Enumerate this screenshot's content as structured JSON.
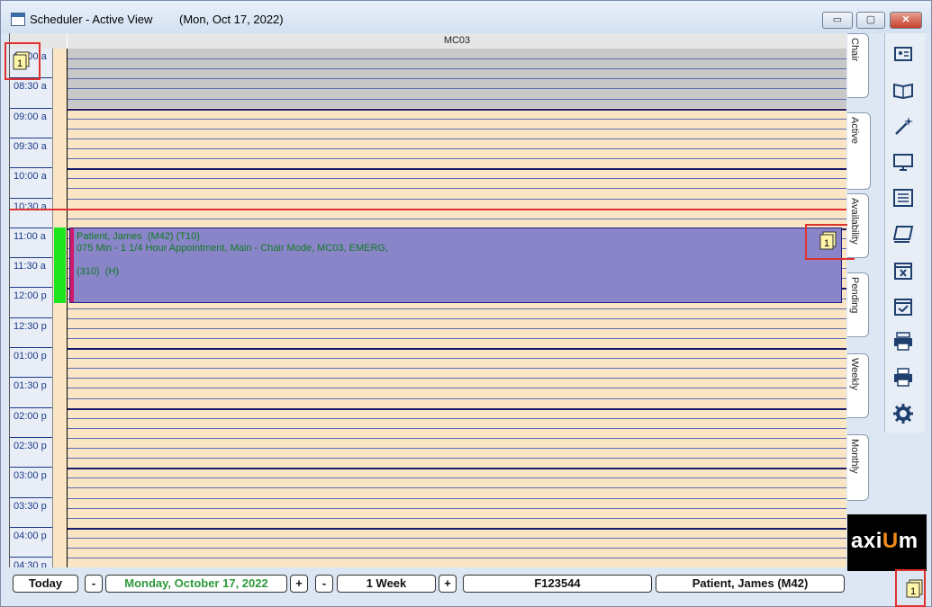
{
  "window": {
    "title": "Scheduler - Active View",
    "date": "(Mon, Oct 17, 2022)",
    "minimize": "▭",
    "maximize": "▢",
    "close": "✕"
  },
  "column": {
    "header": "MC03"
  },
  "times": [
    "08:00 a",
    "08:30 a",
    "09:00 a",
    "09:30 a",
    "10:00 a",
    "10:30 a",
    "11:00 a",
    "11:30 a",
    "12:00 p",
    "12:30 p",
    "01:00 p",
    "01:30 p",
    "02:00 p",
    "02:30 p",
    "03:00 p",
    "03:30 p",
    "04:00 p",
    "04:30 p"
  ],
  "appointment": {
    "line1": "Patient, James  (M42) (T10)",
    "line2": "075 Min - 1 1/4 Hour Appointment, Main - Chair Mode, MC03, EMERG,",
    "line3": "(310)  (H)",
    "note_count": "1"
  },
  "corner_note_count": "1",
  "footer_note_count": "1",
  "tabs": [
    "Chair",
    "Active",
    "Availability",
    "Pending",
    "Weekly",
    "Monthly"
  ],
  "active_tab": "Active",
  "toolbar": [
    "contact-card-icon",
    "book-icon",
    "magic-wand-icon",
    "monitor-icon",
    "list-icon",
    "layers-icon",
    "calendar-x-icon",
    "calendar-check-icon",
    "printer-queue-icon",
    "printer-icon",
    "gear-icon"
  ],
  "brand": {
    "prefix": "axi",
    "accent": "U",
    "suffix": "m"
  },
  "bottom": {
    "today": "Today",
    "minus": "-",
    "date": "Monday, October 17, 2022",
    "plus": "+",
    "minus2": "-",
    "range": "1 Week",
    "plus2": "+",
    "chart_id": "F123544",
    "patient": "Patient, James  (M42)"
  },
  "colors": {
    "grid": "#fae6c4",
    "blocked": "#c8c8c8",
    "appointment": "#8a85c9",
    "now_line": "#e03030",
    "status": "#1ee61e",
    "date_text": "#2d9a3c",
    "brand_accent": "#f08a18"
  }
}
